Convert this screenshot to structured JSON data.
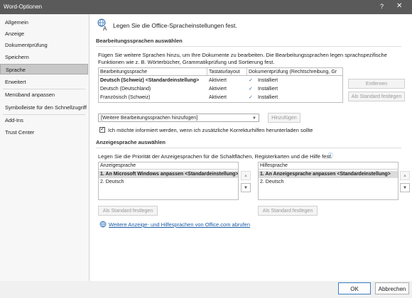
{
  "window": {
    "title": "Word-Optionen",
    "help": "?",
    "close": "✕"
  },
  "sidebar": {
    "items": [
      {
        "label": "Allgemein"
      },
      {
        "label": "Anzeige"
      },
      {
        "label": "Dokumentprüfung"
      },
      {
        "label": "Speichern"
      },
      {
        "label": "Sprache"
      },
      {
        "label": "Erweitert"
      },
      {
        "label": "Menüband anpassen"
      },
      {
        "label": "Symbolleiste für den Schnellzugriff"
      },
      {
        "label": "Add-Ins"
      },
      {
        "label": "Trust Center"
      }
    ],
    "active": "Sprache"
  },
  "main": {
    "heading": "Legen Sie die Office-Spracheinstellungen fest.",
    "editing": {
      "section_title": "Bearbeitungssprachen auswählen",
      "description_line1": "Fügen Sie weitere Sprachen hinzu, um Ihre Dokumente zu bearbeiten. Die Bearbeitungssprachen legen sprachspezifische",
      "description_line2": "Funktionen wie z. B. Wörterbücher, Grammatikprüfung und Sortierung fest.",
      "columns": [
        "Bearbeitungssprache",
        "Tastaturlayout",
        "Dokumentprüfung (Rechtschreibung, Gr"
      ],
      "rows": [
        {
          "language": "Deutsch (Schweiz) <Standardeinstellung>",
          "keyboard": "Aktiviert",
          "proofing": "Installiert",
          "bold": true
        },
        {
          "language": "Deutsch (Deutschland)",
          "keyboard": "Aktiviert",
          "proofing": "Installiert",
          "bold": false
        },
        {
          "language": "Französisch (Schweiz)",
          "keyboard": "Aktiviert",
          "proofing": "Installiert",
          "bold": false
        }
      ],
      "remove_button": "Entfernen",
      "set_default_button": "Als Standard festlegen",
      "add_select_value": "[Weitere Bearbeitungssprachen hinzufügen]",
      "add_button": "Hinzufügen",
      "notify_checkbox_label": "Ich möchte informiert werden, wenn ich zusätzliche Korrekturhilfen herunterladen sollte",
      "notify_checked": true
    },
    "display": {
      "section_title": "Anzeigesprache auswählen",
      "description": "Legen Sie die Priorität der Anzeigesprachen für die Schaltflächen, Registerkarten und die Hilfe fest.",
      "display_list": {
        "header": "Anzeigesprache",
        "items": [
          "1.    An Microsoft Windows anpassen <Standardeinstellung>",
          "2.    Deutsch"
        ]
      },
      "help_list": {
        "header": "Hilfesprache",
        "items": [
          "1.    An Anzeigesprache anpassen <Standardeinstellung>",
          "2.    Deutsch"
        ]
      },
      "display_set_default": "Als Standard festlegen",
      "help_set_default": "Als Standard festlegen",
      "more_link": "Weitere Anzeige- und Hilfesprachen von Office.com abrufen"
    }
  },
  "footer": {
    "ok": "OK",
    "cancel": "Abbrechen"
  },
  "colors": {
    "titlebar": "#5a5a5a",
    "link": "#1a5aa6",
    "active_nav": "#c8c8c8"
  }
}
